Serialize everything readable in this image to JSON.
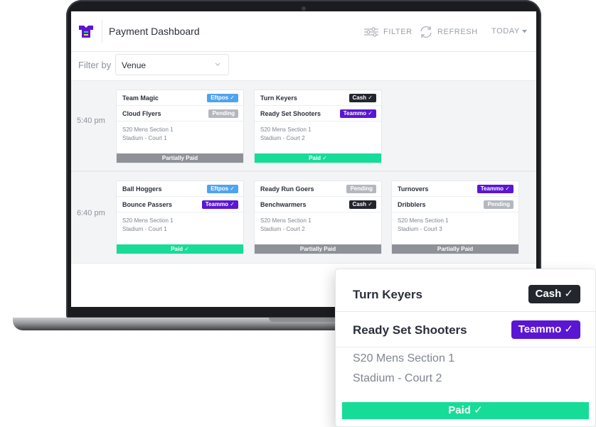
{
  "app": {
    "title": "Payment Dashboard"
  },
  "header": {
    "filter_label": "FILTER",
    "refresh_label": "REFRESH",
    "date_label": "TODAY"
  },
  "filter": {
    "label": "Filter by",
    "selected": "Venue"
  },
  "colors": {
    "paid": "#16dc98",
    "partially_paid": "#8e9197",
    "eftpos": "#4fa3ee",
    "cash": "#23262d",
    "teammo": "#5b16d3",
    "pending": "#b4b8be",
    "brand": "#5b16d3"
  },
  "slots": [
    {
      "time": "5:40 pm",
      "games": [
        {
          "teams": [
            {
              "name": "Team Magic",
              "badge": "Eftpos ✓",
              "badge_type": "eftpos"
            },
            {
              "name": "Cloud Flyers",
              "badge": "Pending",
              "badge_type": "pending"
            }
          ],
          "section": "S20 Mens Section 1",
          "court": "Stadium - Court 1",
          "status": "Partially Paid"
        },
        {
          "teams": [
            {
              "name": "Turn Keyers",
              "badge": "Cash ✓",
              "badge_type": "cash"
            },
            {
              "name": "Ready Set Shooters",
              "badge": "Teammo ✓",
              "badge_type": "teammo"
            }
          ],
          "section": "S20 Mens Section 1",
          "court": "Stadium - Court 2",
          "status": "Paid ✓"
        }
      ]
    },
    {
      "time": "6:40 pm",
      "games": [
        {
          "teams": [
            {
              "name": "Ball Hoggers",
              "badge": "Eftpos ✓",
              "badge_type": "eftpos"
            },
            {
              "name": "Bounce Passers",
              "badge": "Teammo ✓",
              "badge_type": "teammo"
            }
          ],
          "section": "S20 Mens Section 1",
          "court": "Stadium - Court 1",
          "status": "Paid ✓"
        },
        {
          "teams": [
            {
              "name": "Ready Run Goers",
              "badge": "Pending",
              "badge_type": "pending"
            },
            {
              "name": "Benchwarmers",
              "badge": "Cash ✓",
              "badge_type": "cash"
            }
          ],
          "section": "S20 Mens Section 1",
          "court": "Stadium - Court 2",
          "status": "Partially Paid"
        },
        {
          "teams": [
            {
              "name": "Turnovers",
              "badge": "Teammo ✓",
              "badge_type": "teammo"
            },
            {
              "name": "Dribblers",
              "badge": "Pending",
              "badge_type": "pending"
            }
          ],
          "section": "S20 Mens Section 1",
          "court": "Stadium - Court 3",
          "status": "Partially Paid"
        }
      ]
    }
  ],
  "zoom": {
    "teams": [
      {
        "name": "Turn Keyers",
        "badge": "Cash ✓",
        "badge_type": "cash"
      },
      {
        "name": "Ready Set Shooters",
        "badge": "Teammo ✓",
        "badge_type": "teammo"
      }
    ],
    "section": "S20 Mens Section 1",
    "court": "Stadium - Court 2",
    "status": "Paid ✓"
  }
}
